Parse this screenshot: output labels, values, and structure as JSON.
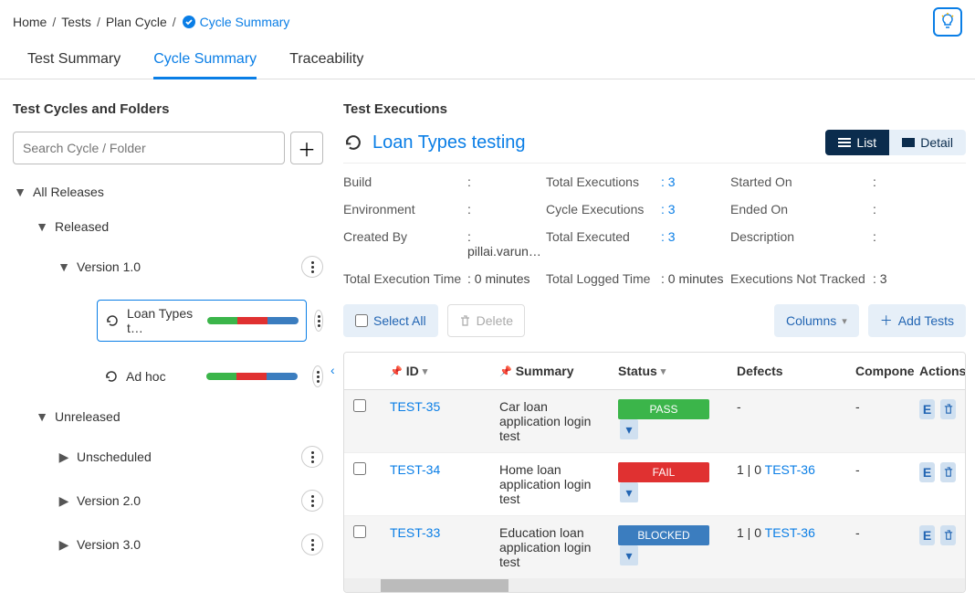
{
  "breadcrumb": {
    "home": "Home",
    "tests": "Tests",
    "plan": "Plan Cycle",
    "current": "Cycle Summary"
  },
  "tabs": {
    "summary": "Test Summary",
    "cycle": "Cycle Summary",
    "trace": "Traceability"
  },
  "sidebar": {
    "heading": "Test Cycles and Folders",
    "search_ph": "Search Cycle / Folder",
    "all": "All Releases",
    "released": "Released",
    "v1": "Version 1.0",
    "loan": "Loan Types t…",
    "adhoc": "Ad hoc",
    "unreleased": "Unreleased",
    "unscheduled": "Unscheduled",
    "v2": "Version 2.0",
    "v3": "Version 3.0"
  },
  "main": {
    "heading": "Test Executions",
    "title": "Loan Types testing",
    "view_list": "List",
    "view_detail": "Detail",
    "labels": {
      "build": "Build",
      "env": "Environment",
      "created_by": "Created By",
      "tet": "Total Execution Time",
      "total_exec": "Total Executions",
      "cycle_exec": "Cycle Executions",
      "total_executed": "Total Executed",
      "logged": "Total Logged Time",
      "started": "Started On",
      "ended": "Ended On",
      "desc": "Description",
      "not_tracked": "Executions Not Tracked"
    },
    "values": {
      "build": ":",
      "env": ":",
      "created_by": ": pillai.varun…",
      "tet": ": 0 minutes",
      "total_exec": "3",
      "cycle_exec": "3",
      "total_executed": "3",
      "logged": ": 0 minutes",
      "started": ":",
      "ended": ":",
      "desc": ":",
      "not_tracked": ": 3"
    },
    "select_all": "Select All",
    "delete": "Delete",
    "columns": "Columns",
    "add_tests": "Add Tests",
    "headers": {
      "id": "ID",
      "summary": "Summary",
      "status": "Status",
      "defects": "Defects",
      "component": "Compone",
      "actions": "Actions"
    },
    "rows": [
      {
        "id": "TEST-35",
        "summary": "Car loan application login test",
        "status": "PASS",
        "defcount": "-",
        "defects": "",
        "component": "-"
      },
      {
        "id": "TEST-34",
        "summary": "Home loan application login test",
        "status": "FAIL",
        "defcount": "1 | 0",
        "defects": "TEST-36",
        "component": "-"
      },
      {
        "id": "TEST-33",
        "summary": "Education loan application login test",
        "status": "BLOCKED",
        "defcount": "1 | 0",
        "defects": "TEST-36",
        "component": "-"
      }
    ],
    "e": "E"
  }
}
